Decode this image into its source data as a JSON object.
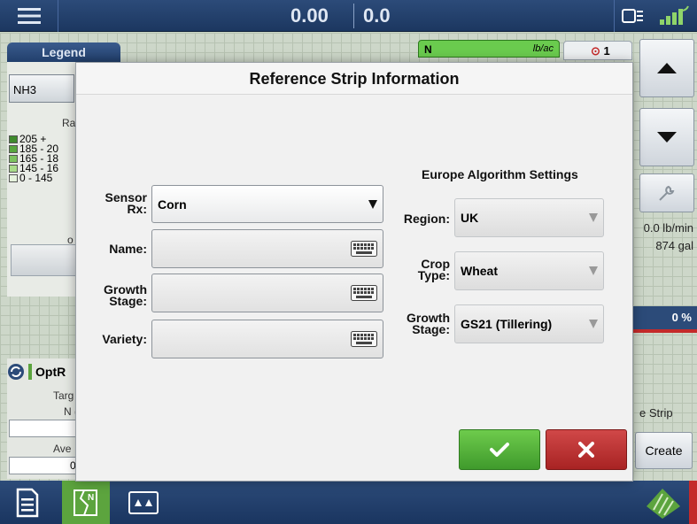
{
  "topbar": {
    "readout_left": "0.00",
    "readout_right": "0.0",
    "icons": [
      "menu-icon",
      "display-icon",
      "gps-signal-icon"
    ]
  },
  "legend": {
    "tab_label": "Legend",
    "product_button": "NH3",
    "rate_label": "Ra",
    "items": [
      {
        "label": "205 +",
        "color": "#3f8a2d"
      },
      {
        "label": "185 - 20",
        "color": "#58a63e"
      },
      {
        "label": "165 - 18",
        "color": "#7cc25f"
      },
      {
        "label": "145 - 16",
        "color": "#a9dc8a"
      },
      {
        "label": "0 - 145",
        "color": "#e6f3dd"
      }
    ],
    "small_label": "o"
  },
  "map_top": {
    "n_tab_label": "N",
    "n_tab_unit": "lb/ac",
    "alert_count": "1"
  },
  "right_panel": {
    "rate": "0.0 lb/min",
    "volume": "874 gal",
    "percent": "0 %",
    "strip_label": "e Strip",
    "create_button": "Create"
  },
  "optrx_panel": {
    "title": "OptR",
    "target_label": "Targ",
    "n_label": "N (",
    "average_label": "Ave",
    "value": "0"
  },
  "modal": {
    "title": "Reference Strip Information",
    "sensor_rx_label_line1": "Sensor",
    "sensor_rx_label_line2": "Rx:",
    "sensor_rx_value": "Corn",
    "name_label": "Name:",
    "growth_stage_label_line1": "Growth",
    "growth_stage_label_line2": "Stage:",
    "variety_label": "Variety:",
    "europe_section_title": "Europe Algorithm Settings",
    "region_label": "Region:",
    "region_value": "UK",
    "crop_type_label_line1": "Crop",
    "crop_type_label_line2": "Type:",
    "crop_type_value": "Wheat",
    "eu_growth_label_line1": "Growth",
    "eu_growth_label_line2": "Stage:",
    "eu_growth_value": "GS21 (Tillering)",
    "ok_icon": "checkmark-icon",
    "cancel_icon": "close-icon"
  },
  "colors": {
    "nav_blue": "#2c4b79",
    "accept_green": "#4caf35",
    "cancel_red": "#b52c2c"
  }
}
